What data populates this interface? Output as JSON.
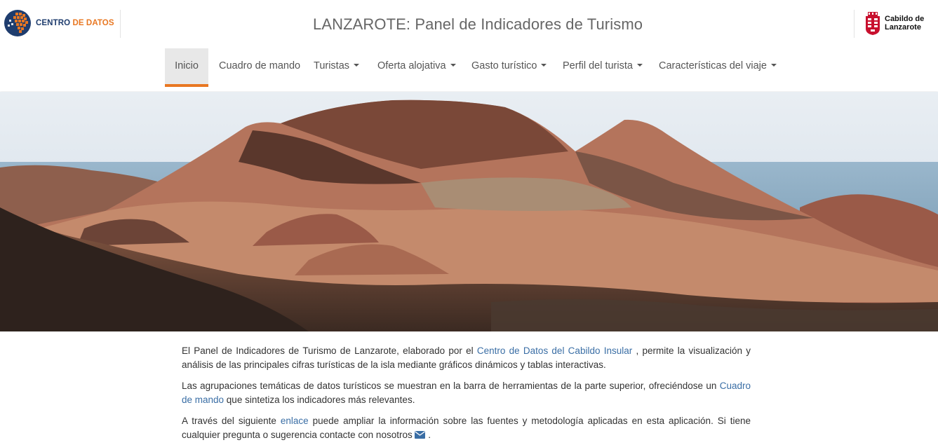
{
  "header": {
    "logo_left": {
      "part1": "CENTRO ",
      "part2": "DE DATOS"
    },
    "title": "LANZAROTE: Panel de Indicadores de Turismo",
    "logo_right": {
      "line1": "Cabildo de",
      "line2": "Lanzarote"
    }
  },
  "nav": {
    "items": [
      {
        "label": "Inicio",
        "active": true
      },
      {
        "label": "Cuadro de mando"
      },
      {
        "label": "Turistas"
      },
      {
        "label": "Oferta alojativa"
      },
      {
        "label": "Gasto turístico"
      },
      {
        "label": "Perfil del turista"
      },
      {
        "label": "Características del viaje"
      }
    ]
  },
  "intro": {
    "p1_a": "El Panel de Indicadores de Turismo de Lanzarote, elaborado por el ",
    "p1_link": "Centro de Datos del Cabildo Insular",
    "p1_b": " , permite la visualización y análisis de las principales cifras turísticas de la isla mediante gráficos dinámicos y tablas interactivas.",
    "p2_a": "Las agrupaciones temáticas de datos turísticos se muestran en la barra de herramientas de la parte superior, ofreciéndose un ",
    "p2_link": "Cuadro de mando",
    "p2_b": " que sintetiza los indicadores más relevantes.",
    "p3_a": "A través del siguiente ",
    "p3_link": "enlace",
    "p3_b": " puede ampliar la información sobre las fuentes y metodología aplicadas en esta aplicación. Si tiene cualquier pregunta o sugerencia contacte con nosotros ",
    "p3_end": " ."
  },
  "colors": {
    "accent": "#e87722",
    "brand_blue": "#1f3d6e",
    "link": "#3a6ea5",
    "cabildo_red": "#c8102e"
  },
  "icons": {
    "logo_left": "centro-de-datos-globe-icon",
    "logo_right": "cabildo-shield-icon",
    "dropdown": "caret-down-icon",
    "contact": "envelope-icon"
  }
}
